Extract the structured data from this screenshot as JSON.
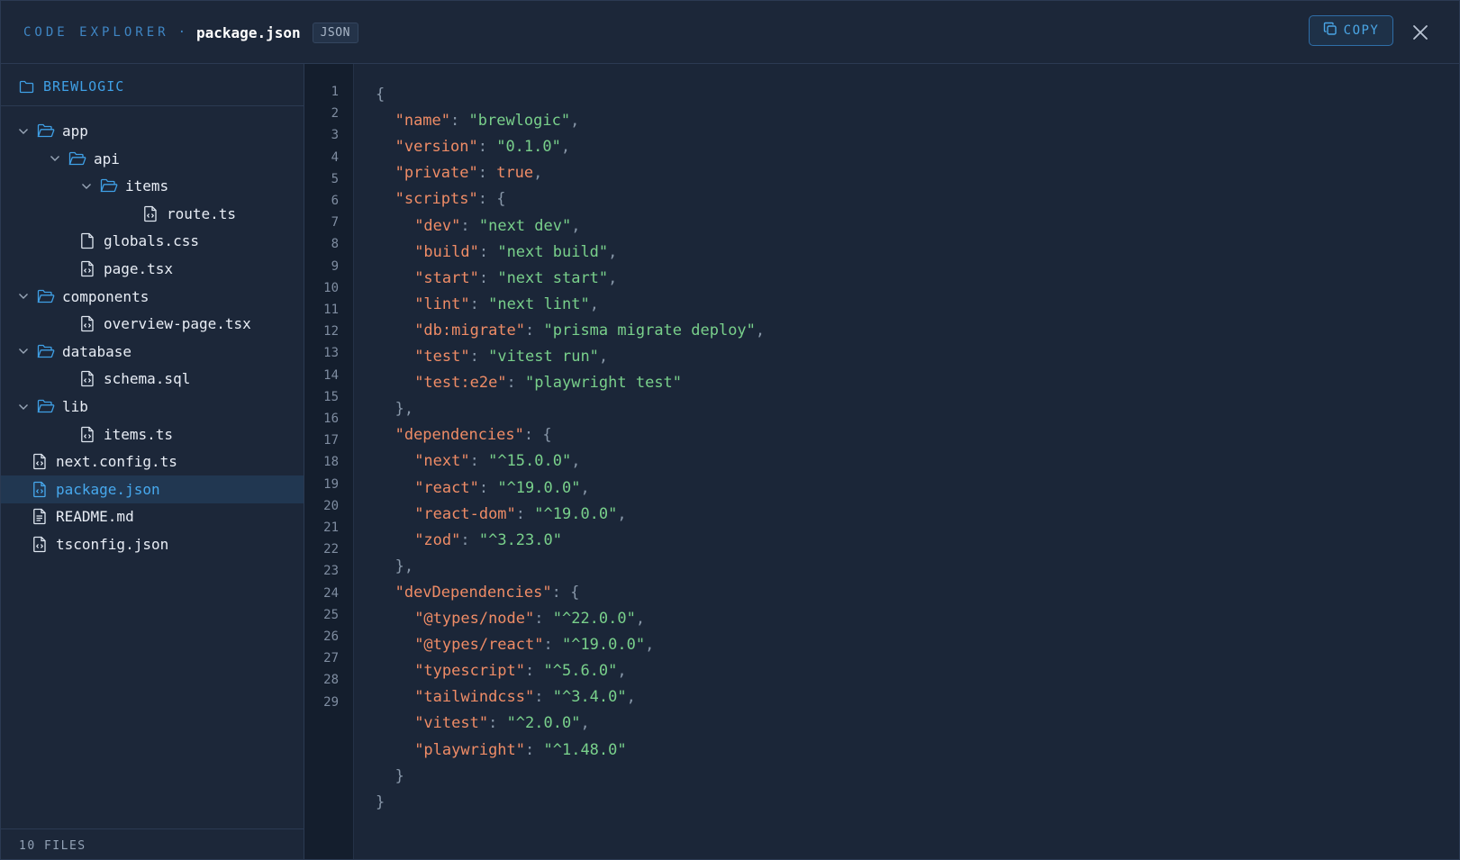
{
  "header": {
    "app_name": "CODE EXPLORER",
    "separator": "·",
    "file_name": "package.json",
    "file_type_badge": "JSON",
    "copy_label": "COPY"
  },
  "sidebar": {
    "project": "BREWLOGIC",
    "tree": [
      {
        "label": "app",
        "type": "folder",
        "depth": 0,
        "expanded": true
      },
      {
        "label": "api",
        "type": "folder",
        "depth": 1,
        "expanded": true
      },
      {
        "label": "items",
        "type": "folder",
        "depth": 2,
        "expanded": true
      },
      {
        "label": "route.ts",
        "type": "code-file",
        "depth": 3
      },
      {
        "label": "globals.css",
        "type": "file",
        "depth": 1
      },
      {
        "label": "page.tsx",
        "type": "code-file",
        "depth": 1
      },
      {
        "label": "components",
        "type": "folder",
        "depth": 0,
        "expanded": true
      },
      {
        "label": "overview-page.tsx",
        "type": "code-file",
        "depth": 1
      },
      {
        "label": "database",
        "type": "folder",
        "depth": 0,
        "expanded": true
      },
      {
        "label": "schema.sql",
        "type": "code-file",
        "depth": 1
      },
      {
        "label": "lib",
        "type": "folder",
        "depth": 0,
        "expanded": true
      },
      {
        "label": "items.ts",
        "type": "code-file",
        "depth": 1
      },
      {
        "label": "next.config.ts",
        "type": "code-file",
        "depth": 0.5
      },
      {
        "label": "package.json",
        "type": "code-file",
        "depth": 0.5,
        "selected": true
      },
      {
        "label": "README.md",
        "type": "text-file",
        "depth": 0.5
      },
      {
        "label": "tsconfig.json",
        "type": "code-file",
        "depth": 0.5
      }
    ],
    "footer": "10 FILES"
  },
  "editor": {
    "line_numbers": [
      "1",
      "2",
      "3",
      "4",
      "5",
      "6",
      "7",
      "8",
      "9",
      "10",
      "11",
      "12",
      "13",
      "14",
      "15",
      "16",
      "17",
      "18",
      "19",
      "20",
      "21",
      "22",
      "23",
      "24",
      "25",
      "26",
      "27",
      "28",
      "29"
    ],
    "lines": [
      {
        "indent": 0,
        "tokens": [
          [
            "p",
            "{"
          ]
        ]
      },
      {
        "indent": 1,
        "tokens": [
          [
            "k",
            "\"name\""
          ],
          [
            "p",
            ": "
          ],
          [
            "s",
            "\"brewlogic\""
          ],
          [
            "p",
            ","
          ]
        ]
      },
      {
        "indent": 1,
        "tokens": [
          [
            "k",
            "\"version\""
          ],
          [
            "p",
            ": "
          ],
          [
            "s",
            "\"0.1.0\""
          ],
          [
            "p",
            ","
          ]
        ]
      },
      {
        "indent": 1,
        "tokens": [
          [
            "k",
            "\"private\""
          ],
          [
            "p",
            ": "
          ],
          [
            "b",
            "true"
          ],
          [
            "p",
            ","
          ]
        ]
      },
      {
        "indent": 1,
        "tokens": [
          [
            "k",
            "\"scripts\""
          ],
          [
            "p",
            ": {"
          ]
        ]
      },
      {
        "indent": 2,
        "tokens": [
          [
            "k",
            "\"dev\""
          ],
          [
            "p",
            ": "
          ],
          [
            "s",
            "\"next dev\""
          ],
          [
            "p",
            ","
          ]
        ]
      },
      {
        "indent": 2,
        "tokens": [
          [
            "k",
            "\"build\""
          ],
          [
            "p",
            ": "
          ],
          [
            "s",
            "\"next build\""
          ],
          [
            "p",
            ","
          ]
        ]
      },
      {
        "indent": 2,
        "tokens": [
          [
            "k",
            "\"start\""
          ],
          [
            "p",
            ": "
          ],
          [
            "s",
            "\"next start\""
          ],
          [
            "p",
            ","
          ]
        ]
      },
      {
        "indent": 2,
        "tokens": [
          [
            "k",
            "\"lint\""
          ],
          [
            "p",
            ": "
          ],
          [
            "s",
            "\"next lint\""
          ],
          [
            "p",
            ","
          ]
        ]
      },
      {
        "indent": 2,
        "tokens": [
          [
            "k",
            "\"db:migrate\""
          ],
          [
            "p",
            ": "
          ],
          [
            "s",
            "\"prisma migrate deploy\""
          ],
          [
            "p",
            ","
          ]
        ]
      },
      {
        "indent": 2,
        "tokens": [
          [
            "k",
            "\"test\""
          ],
          [
            "p",
            ": "
          ],
          [
            "s",
            "\"vitest run\""
          ],
          [
            "p",
            ","
          ]
        ]
      },
      {
        "indent": 2,
        "tokens": [
          [
            "k",
            "\"test:e2e\""
          ],
          [
            "p",
            ": "
          ],
          [
            "s",
            "\"playwright test\""
          ]
        ]
      },
      {
        "indent": 1,
        "tokens": [
          [
            "p",
            "},"
          ]
        ]
      },
      {
        "indent": 1,
        "tokens": [
          [
            "k",
            "\"dependencies\""
          ],
          [
            "p",
            ": {"
          ]
        ]
      },
      {
        "indent": 2,
        "tokens": [
          [
            "k",
            "\"next\""
          ],
          [
            "p",
            ": "
          ],
          [
            "s",
            "\"^15.0.0\""
          ],
          [
            "p",
            ","
          ]
        ]
      },
      {
        "indent": 2,
        "tokens": [
          [
            "k",
            "\"react\""
          ],
          [
            "p",
            ": "
          ],
          [
            "s",
            "\"^19.0.0\""
          ],
          [
            "p",
            ","
          ]
        ]
      },
      {
        "indent": 2,
        "tokens": [
          [
            "k",
            "\"react-dom\""
          ],
          [
            "p",
            ": "
          ],
          [
            "s",
            "\"^19.0.0\""
          ],
          [
            "p",
            ","
          ]
        ]
      },
      {
        "indent": 2,
        "tokens": [
          [
            "k",
            "\"zod\""
          ],
          [
            "p",
            ": "
          ],
          [
            "s",
            "\"^3.23.0\""
          ]
        ]
      },
      {
        "indent": 1,
        "tokens": [
          [
            "p",
            "},"
          ]
        ]
      },
      {
        "indent": 1,
        "tokens": [
          [
            "k",
            "\"devDependencies\""
          ],
          [
            "p",
            ": {"
          ]
        ]
      },
      {
        "indent": 2,
        "tokens": [
          [
            "k",
            "\"@types/node\""
          ],
          [
            "p",
            ": "
          ],
          [
            "s",
            "\"^22.0.0\""
          ],
          [
            "p",
            ","
          ]
        ]
      },
      {
        "indent": 2,
        "tokens": [
          [
            "k",
            "\"@types/react\""
          ],
          [
            "p",
            ": "
          ],
          [
            "s",
            "\"^19.0.0\""
          ],
          [
            "p",
            ","
          ]
        ]
      },
      {
        "indent": 2,
        "tokens": [
          [
            "k",
            "\"typescript\""
          ],
          [
            "p",
            ": "
          ],
          [
            "s",
            "\"^5.6.0\""
          ],
          [
            "p",
            ","
          ]
        ]
      },
      {
        "indent": 2,
        "tokens": [
          [
            "k",
            "\"tailwindcss\""
          ],
          [
            "p",
            ": "
          ],
          [
            "s",
            "\"^3.4.0\""
          ],
          [
            "p",
            ","
          ]
        ]
      },
      {
        "indent": 2,
        "tokens": [
          [
            "k",
            "\"vitest\""
          ],
          [
            "p",
            ": "
          ],
          [
            "s",
            "\"^2.0.0\""
          ],
          [
            "p",
            ","
          ]
        ]
      },
      {
        "indent": 2,
        "tokens": [
          [
            "k",
            "\"playwright\""
          ],
          [
            "p",
            ": "
          ],
          [
            "s",
            "\"^1.48.0\""
          ]
        ]
      },
      {
        "indent": 1,
        "tokens": [
          [
            "p",
            "}"
          ]
        ]
      },
      {
        "indent": 0,
        "tokens": [
          [
            "p",
            "}"
          ]
        ]
      }
    ]
  },
  "colors": {
    "background": "#1b2638",
    "accent": "#3fa0e6",
    "key": "#ef8c66",
    "string": "#79d08b",
    "selection": "#213751"
  }
}
